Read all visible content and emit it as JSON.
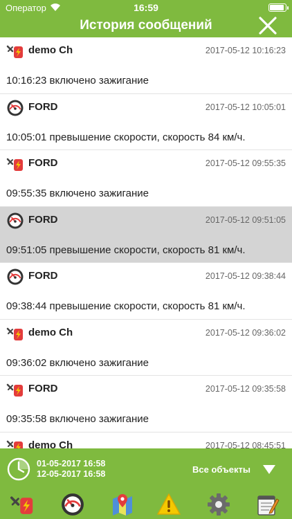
{
  "status_bar": {
    "carrier": "Оператор",
    "time": "16:59",
    "battery_level": 0.9
  },
  "header": {
    "title": "История сообщений"
  },
  "messages": [
    {
      "icon": "ignition-icon",
      "object": "demo Ch",
      "date": "2017-05-12 10:16:23",
      "text": "10:16:23 включено зажигание",
      "selected": false
    },
    {
      "icon": "speedometer-icon",
      "object": "FORD",
      "date": "2017-05-12 10:05:01",
      "text": "10:05:01 превышение скорости, скорость 84 км/ч.",
      "selected": false
    },
    {
      "icon": "ignition-icon",
      "object": "FORD",
      "date": "2017-05-12 09:55:35",
      "text": "09:55:35 включено зажигание",
      "selected": false
    },
    {
      "icon": "speedometer-icon",
      "object": "FORD",
      "date": "2017-05-12 09:51:05",
      "text": "09:51:05 превышение скорости, скорость 81 км/ч.",
      "selected": true
    },
    {
      "icon": "speedometer-icon",
      "object": "FORD",
      "date": "2017-05-12 09:38:44",
      "text": "09:38:44 превышение скорости, скорость 81 км/ч.",
      "selected": false
    },
    {
      "icon": "ignition-icon",
      "object": "demo Ch",
      "date": "2017-05-12 09:36:02",
      "text": "09:36:02 включено зажигание",
      "selected": false
    },
    {
      "icon": "ignition-icon",
      "object": "FORD",
      "date": "2017-05-12 09:35:58",
      "text": "09:35:58 включено зажигание",
      "selected": false
    },
    {
      "icon": "ignition-icon",
      "object": "demo Ch",
      "date": "2017-05-12 08:45:51",
      "text": "",
      "selected": false
    }
  ],
  "filter": {
    "date_from": "01-05-2017 16:58",
    "date_to": "12-05-2017 16:58",
    "objects_label": "Все объекты"
  },
  "tabs": [
    {
      "icon": "ignition-icon"
    },
    {
      "icon": "speedometer-icon"
    },
    {
      "icon": "map-pin-icon"
    },
    {
      "icon": "warning-icon"
    },
    {
      "icon": "gear-icon"
    },
    {
      "icon": "notepad-icon"
    }
  ],
  "colors": {
    "accent": "#7fba3f",
    "selected_row": "#d4d4d4",
    "warning": "#f5c800",
    "ignition_red": "#e33c3c"
  }
}
